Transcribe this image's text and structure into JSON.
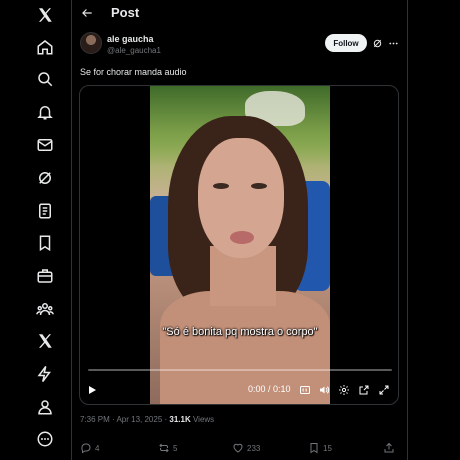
{
  "nav": {
    "items": [
      {
        "icon": "x-logo-icon"
      },
      {
        "icon": "home-icon"
      },
      {
        "icon": "search-icon"
      },
      {
        "icon": "bell-icon"
      },
      {
        "icon": "mail-icon"
      },
      {
        "icon": "grok-icon"
      },
      {
        "icon": "lists-icon"
      },
      {
        "icon": "bookmark-icon"
      },
      {
        "icon": "briefcase-icon"
      },
      {
        "icon": "communities-icon"
      },
      {
        "icon": "premium-x-icon"
      },
      {
        "icon": "lightning-icon"
      },
      {
        "icon": "profile-icon"
      },
      {
        "icon": "more-circle-icon"
      }
    ]
  },
  "header": {
    "title": "Post"
  },
  "post": {
    "display_name": "ale gaucha",
    "handle": "@ale_gaucha1",
    "follow_label": "Follow",
    "text": "Se for chorar manda audio",
    "video": {
      "caption": "\"Só é bonita pq mostra o corpo\"",
      "time": "0:00 / 0:10",
      "progress": 0
    },
    "timestamp": "7:36 PM · Apr 13, 2025 · ",
    "views_count": "31.1K",
    "views_label": " Views",
    "stats": {
      "replies": "4",
      "reposts": "5",
      "likes": "233",
      "bookmarks": "15"
    }
  },
  "colors": {
    "background": "#000000",
    "text": "#e7e9ea",
    "muted": "#71767b",
    "border": "#2f3336",
    "follow_bg": "#eff3f4"
  }
}
